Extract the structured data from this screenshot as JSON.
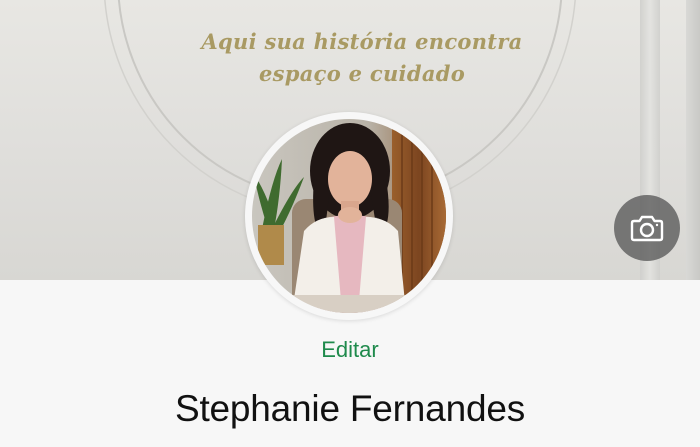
{
  "cover": {
    "tagline_line1": "Aqui sua história encontra",
    "tagline_line2": "espaço e cuidado"
  },
  "camera_button": {
    "icon": "camera-icon"
  },
  "profile": {
    "edit_label": "Editar",
    "name": "Stephanie Fernandes"
  },
  "colors": {
    "accent_green": "#1f8a4c",
    "tagline_gold": "#a99a63",
    "name_text": "#111111"
  }
}
